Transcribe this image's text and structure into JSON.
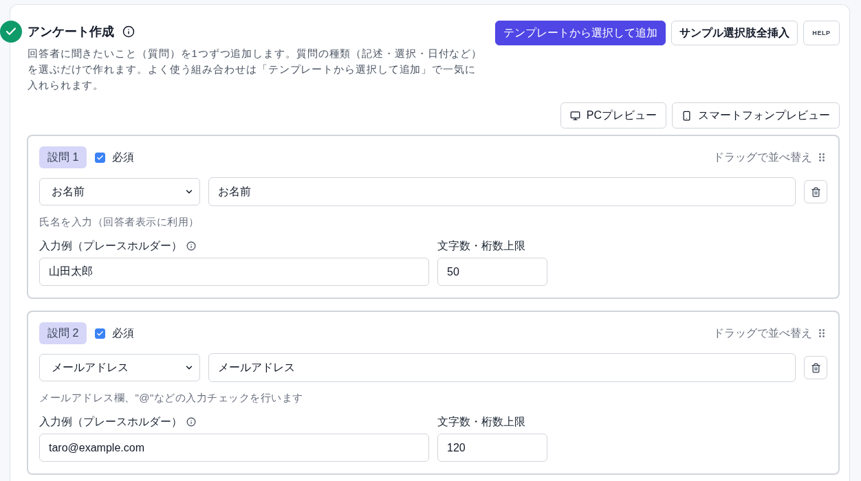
{
  "header": {
    "title": "アンケート作成",
    "description": "回答者に聞きたいこと（質問）を1つずつ追加します。質問の種類（記述・選択・日付など）を選ぶだけで作れます。よく使う組み合わせは「テンプレートから選択して追加」で一気に入れられます。"
  },
  "actions": [
    {
      "label": "テンプレートから選択して追加",
      "kind": "primary"
    },
    {
      "label": "サンプル選択肢全挿入",
      "kind": "strong"
    },
    {
      "label": "HELP",
      "kind": "small"
    }
  ],
  "previews": [
    {
      "label": "PCプレビュー",
      "kind": "desktop"
    },
    {
      "label": "スマートフォンプレビュー",
      "kind": "phone"
    }
  ],
  "questions": [
    {
      "badge": "設問 1",
      "required_label": "必須",
      "required": true,
      "drag_hint": "ドラッグで並べ替え",
      "type": "お名前",
      "question": "お名前",
      "help": "氏名を入力（回答者表示に利用）",
      "example_label": "入力例（プレースホルダー）",
      "example_value": "山田太郎",
      "limit_label": "文字数・桁数上限",
      "limit_value": "50"
    },
    {
      "badge": "設問 2",
      "required_label": "必須",
      "required": true,
      "drag_hint": "ドラッグで並べ替え",
      "type": "メールアドレス",
      "question": "メールアドレス",
      "help": "メールアドレス欄、\"@\"などの入力チェックを行います",
      "example_label": "入力例（プレースホルダー）",
      "example_value": "taro@example.com",
      "limit_label": "文字数・桁数上限",
      "limit_value": "120"
    }
  ]
}
